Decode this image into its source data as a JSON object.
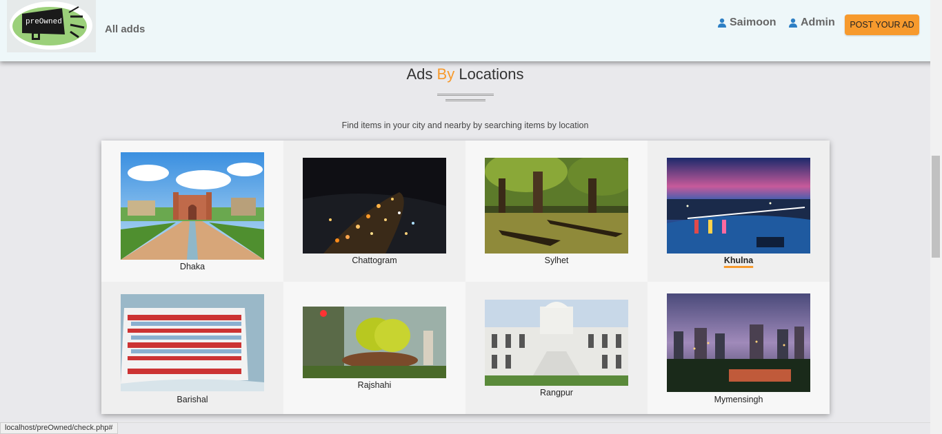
{
  "header": {
    "logo_text": "preOwned",
    "all_adds_label": "All adds",
    "user_name": "Saimoon",
    "admin_label": "Admin",
    "post_button_label": "POST YOUR AD"
  },
  "section": {
    "title_before": "Ads",
    "title_highlight": "By",
    "title_after": "Locations",
    "subtitle": "Find items in your city and nearby by searching items by location"
  },
  "locations": [
    {
      "name": "Dhaka"
    },
    {
      "name": "Chattogram"
    },
    {
      "name": "Sylhet"
    },
    {
      "name": "Khulna"
    },
    {
      "name": "Barishal"
    },
    {
      "name": "Rajshahi"
    },
    {
      "name": "Rangpur"
    },
    {
      "name": "Mymensingh"
    }
  ],
  "status_bar": {
    "url": "localhost/preOwned/check.php#"
  },
  "colors": {
    "accent": "#f79a2d",
    "header_bg": "#eef7f9",
    "page_bg": "#e9e9ec"
  },
  "icons": {
    "user": "user-icon",
    "logo": "megaphone-logo"
  }
}
